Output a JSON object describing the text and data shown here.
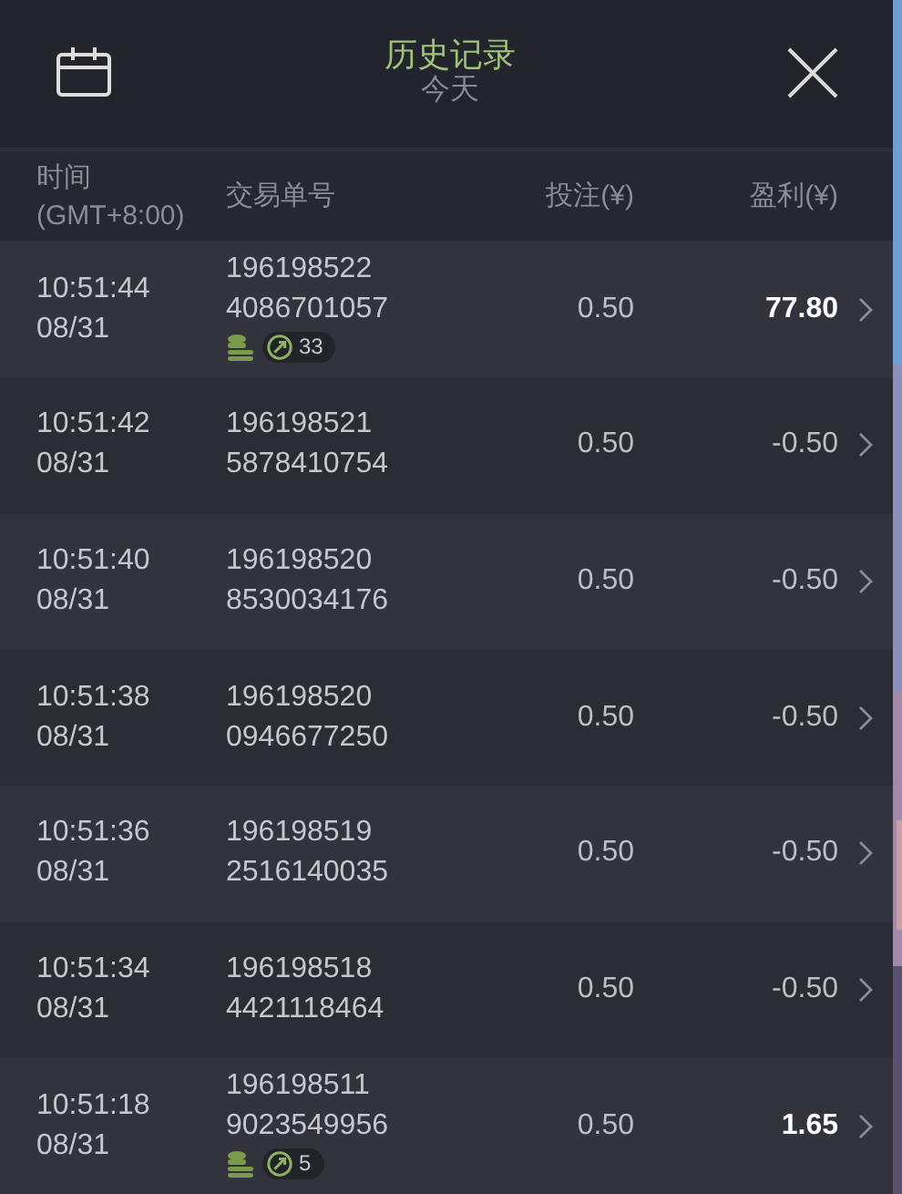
{
  "header": {
    "title": "历史记录",
    "subtitle": "今天"
  },
  "columns": [
    "时间\n(GMT+8:00)",
    "交易单号",
    "投注(¥)",
    "盈利(¥)"
  ],
  "rows": [
    {
      "time": "10:51:44",
      "date": "08/31",
      "order_1": "196198522",
      "order_2": "4086701057",
      "stake": "0.50",
      "profit": "77.80",
      "win": true,
      "badge_count": "33"
    },
    {
      "time": "10:51:42",
      "date": "08/31",
      "order_1": "196198521",
      "order_2": "5878410754",
      "stake": "0.50",
      "profit": "-0.50",
      "win": false
    },
    {
      "time": "10:51:40",
      "date": "08/31",
      "order_1": "196198520",
      "order_2": "8530034176",
      "stake": "0.50",
      "profit": "-0.50",
      "win": false
    },
    {
      "time": "10:51:38",
      "date": "08/31",
      "order_1": "196198520",
      "order_2": "0946677250",
      "stake": "0.50",
      "profit": "-0.50",
      "win": false
    },
    {
      "time": "10:51:36",
      "date": "08/31",
      "order_1": "196198519",
      "order_2": "2516140035",
      "stake": "0.50",
      "profit": "-0.50",
      "win": false
    },
    {
      "time": "10:51:34",
      "date": "08/31",
      "order_1": "196198518",
      "order_2": "4421118464",
      "stake": "0.50",
      "profit": "-0.50",
      "win": false
    },
    {
      "time": "10:51:18",
      "date": "08/31",
      "order_1": "196198511",
      "order_2": "9023549956",
      "stake": "0.50",
      "profit": "1.65",
      "win": true,
      "badge_count": "5"
    }
  ]
}
